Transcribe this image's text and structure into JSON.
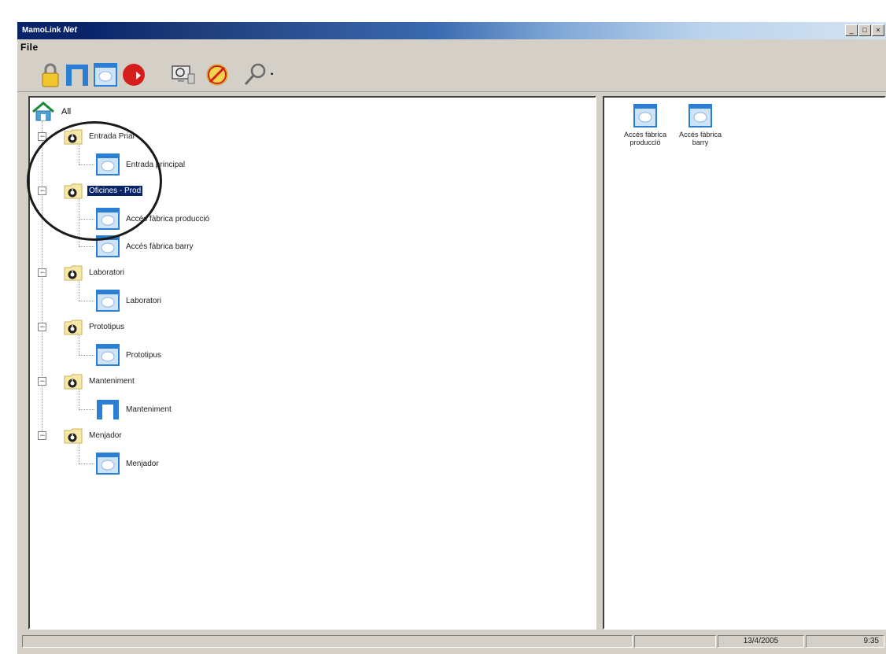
{
  "window": {
    "title_prefix": "MamoLink",
    "title_suffix": "Net",
    "minimize_glyph": "_",
    "maximize_glyph": "□",
    "close_glyph": "×"
  },
  "menu": {
    "file_label": "File"
  },
  "toolbar": {
    "icons": [
      "lock-icon",
      "door-gate-icon",
      "door-card-icon",
      "red-arrow-icon",
      "monitor-magnify-icon",
      "block-clock-icon",
      "key-search-icon"
    ],
    "dropdown_glyph": "·"
  },
  "tree": {
    "root_label": "All",
    "expander_glyph": "−",
    "groups": [
      {
        "label": "Entrada Prial",
        "selected": false,
        "children": [
          {
            "label": "Entrada principal",
            "icon": "door-card-icon"
          }
        ]
      },
      {
        "label": "Oficines - Prod",
        "selected": true,
        "children": [
          {
            "label": "Accés fàbrica producció",
            "icon": "door-card-icon"
          },
          {
            "label": "Accés fàbrica barry",
            "icon": "door-card-icon"
          }
        ]
      },
      {
        "label": "Laboratori",
        "selected": false,
        "children": [
          {
            "label": "Laboratori",
            "icon": "door-card-icon"
          }
        ]
      },
      {
        "label": "Prototipus",
        "selected": false,
        "children": [
          {
            "label": "Prototipus",
            "icon": "door-card-icon"
          }
        ]
      },
      {
        "label": "Manteniment",
        "selected": false,
        "children": [
          {
            "label": "Manteniment",
            "icon": "door-gate-icon"
          }
        ]
      },
      {
        "label": "Menjador",
        "selected": false,
        "children": [
          {
            "label": "Menjador",
            "icon": "door-card-icon"
          }
        ]
      }
    ]
  },
  "list": {
    "items": [
      {
        "label": "Accés fàbrica producció"
      },
      {
        "label": "Accés fàbrica barry"
      }
    ]
  },
  "status": {
    "date": "13/4/2005",
    "time": "9:35"
  },
  "colors": {
    "titlebar_dark": "#0a246a",
    "chrome": "#d4d0c8",
    "selection": "#0a246a",
    "door_blue": "#2a7fd4"
  }
}
